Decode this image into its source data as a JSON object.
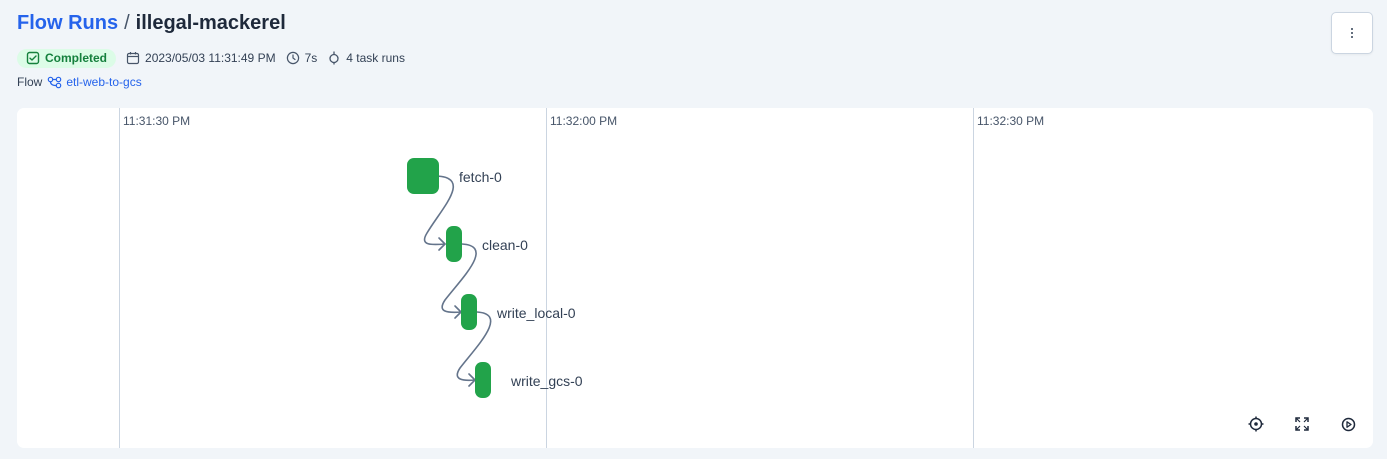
{
  "breadcrumb": {
    "root": "Flow Runs",
    "separator": "/",
    "current": "illegal-mackerel"
  },
  "meta": {
    "state": "Completed",
    "start_time": "2023/05/03 11:31:49 PM",
    "duration": "7s",
    "task_runs": "4 task runs"
  },
  "flow": {
    "label": "Flow",
    "name": "etl-web-to-gcs"
  },
  "timeline": {
    "ticks": [
      "11:31:30 PM",
      "11:32:00 PM",
      "11:32:30 PM"
    ],
    "nodes": [
      "fetch-0",
      "clean-0",
      "write_local-0",
      "write_gcs-0"
    ],
    "state_color": "#22a34a"
  },
  "icons": {
    "state": "check-square-icon",
    "calendar": "calendar-icon",
    "clock": "clock-icon",
    "task_runs": "task-run-icon",
    "flow": "flow-icon",
    "menu": "vertical-dots-icon",
    "recenter": "crosshair-icon",
    "fullscreen": "expand-icon",
    "settings": "speed-icon"
  },
  "colors": {
    "link": "#2563eb",
    "completed_bg": "#dcfce7",
    "completed_text": "#15803d",
    "edge": "#64748b"
  }
}
